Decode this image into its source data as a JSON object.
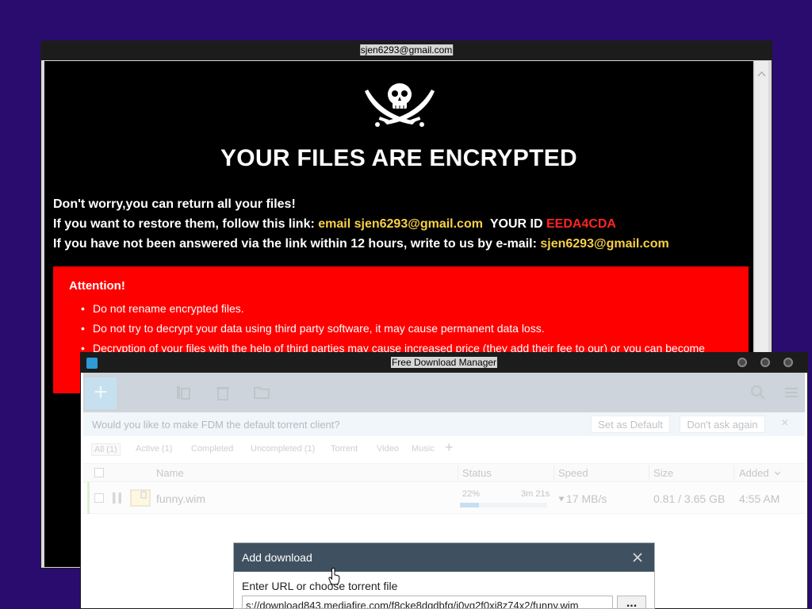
{
  "ransom_window": {
    "title": "sjen6293@gmail.com",
    "headline": "YOUR FILES ARE ENCRYPTED",
    "line1": "Don't worry,you can return all your files!",
    "line2_prefix": "If you want to restore them, follow this link: ",
    "line2_email": "email sjen6293@gmail.com",
    "line2_id_label": "YOUR ID",
    "line2_id": "EEDA4CDA",
    "line3_prefix": "If you have not been answered via the link within 12 hours, write to us by e-mail: ",
    "line3_email": "sjen6293@gmail.com",
    "attention_title": "Attention!",
    "attention_items": [
      "Do not rename encrypted files.",
      "Do not try to decrypt your data using third party software, it may cause permanent data loss.",
      "Decryption of your files with the help of third parties may cause increased price (they add their fee to our) or you can become"
    ]
  },
  "fdm_window": {
    "title": "Free Download Manager",
    "add_button": "+",
    "notice": {
      "text": "Would you like to make FDM the default torrent client?",
      "set_default": "Set as Default",
      "dont_ask": "Don't ask again",
      "close": "×"
    },
    "filters": [
      "All (1)",
      "Active (1)",
      "Completed",
      "Uncompleted (1)",
      "Torrent",
      "Video",
      "Music"
    ],
    "filter_add": "+",
    "columns": {
      "name": "Name",
      "status": "Status",
      "speed": "Speed",
      "size": "Size",
      "added": "Added"
    },
    "download": {
      "name": "funny.wim",
      "progress_text": "22%",
      "progress_fraction": 0.22,
      "time_left": "3m 21s",
      "speed": "17 MB/s",
      "size": "0.81 / 3.65 GB",
      "added": "4:55 AM"
    }
  },
  "add_download_dialog": {
    "title": "Add download",
    "url_label": "Enter URL or choose torrent file",
    "url_value": "s://download843.mediafire.com/f8cke8dqdbfg/j0vg2f0xj8z74x2/funny.wim",
    "browse_label": "..."
  },
  "colors": {
    "desktop": "#2a0c6e",
    "ransom_bg": "#000000",
    "ransom_yellow": "#f7d046",
    "ransom_red_text": "#ff2424",
    "attention_bg": "#ff0000",
    "fdm_dialog_header": "#3f5160"
  }
}
